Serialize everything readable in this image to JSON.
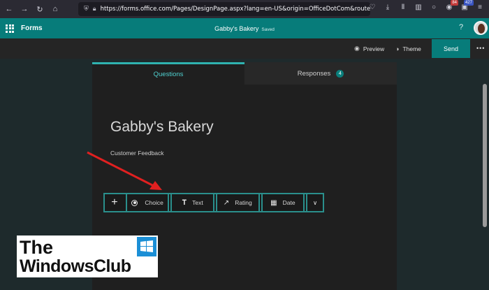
{
  "browser": {
    "url": "https://forms.office.com/Pages/DesignPage.aspx?lang=en-US&origin=OfficeDotCom&route=OfficeHome&r",
    "badges": [
      "84",
      "427"
    ]
  },
  "app": {
    "name": "Forms",
    "doc_title": "Gabby's Bakery",
    "doc_status": "Saved",
    "help": "?",
    "accent": "#077c7a"
  },
  "commands": {
    "preview": "Preview",
    "theme": "Theme",
    "send": "Send",
    "more": "•••"
  },
  "tabs": [
    {
      "label": "Questions",
      "active": true
    },
    {
      "label": "Responses",
      "count": "4",
      "active": false
    }
  ],
  "form": {
    "title": "Gabby's Bakery",
    "description": "Customer Feedback"
  },
  "add_toolbar": {
    "plus": "+",
    "items": [
      {
        "label": "Choice",
        "icon": "radio-icon"
      },
      {
        "label": "Text",
        "icon": "text-icon"
      },
      {
        "label": "Rating",
        "icon": "thumbs-up-icon"
      },
      {
        "label": "Date",
        "icon": "calendar-icon"
      }
    ]
  },
  "watermark": {
    "line1": "The",
    "line2": "WindowsClub"
  }
}
